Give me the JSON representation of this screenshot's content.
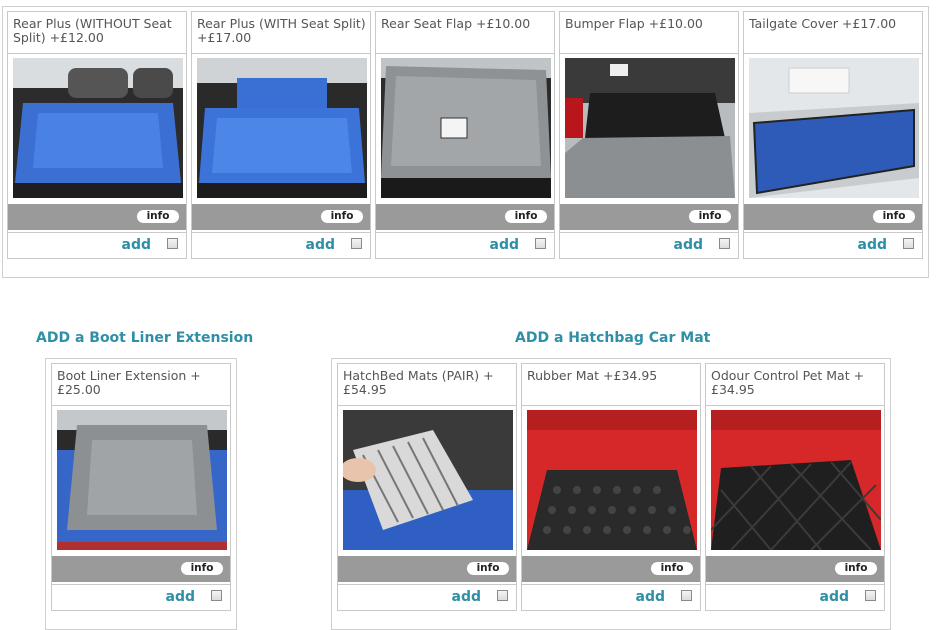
{
  "top_products": [
    {
      "title": "Rear Plus (WITHOUT Seat Split) +£12.00",
      "info_label": "info",
      "add_label": "add",
      "icon": "blue-boot-liner-image"
    },
    {
      "title": "Rear Plus (WITH Seat Split) +£17.00",
      "info_label": "info",
      "add_label": "add",
      "icon": "blue-split-liner-image"
    },
    {
      "title": "Rear Seat Flap +£10.00",
      "info_label": "info",
      "add_label": "add",
      "icon": "grey-seat-flap-image"
    },
    {
      "title": "Bumper Flap +£10.00",
      "info_label": "info",
      "add_label": "add",
      "icon": "bumper-flap-image"
    },
    {
      "title": "Tailgate Cover +£17.00",
      "info_label": "info",
      "add_label": "add",
      "icon": "tailgate-cover-image"
    }
  ],
  "extension_section": {
    "heading": "ADD a Boot Liner Extension",
    "products": [
      {
        "title": "Boot Liner Extension +£25.00",
        "info_label": "info",
        "add_label": "add",
        "icon": "extension-liner-image"
      }
    ]
  },
  "mat_section": {
    "heading": "ADD a Hatchbag Car Mat",
    "products": [
      {
        "title": "HatchBed Mats (PAIR) +£54.95",
        "info_label": "info",
        "add_label": "add",
        "icon": "hatchbed-mat-image"
      },
      {
        "title": "Rubber Mat +£34.95",
        "info_label": "info",
        "add_label": "add",
        "icon": "rubber-mat-image"
      },
      {
        "title": "Odour Control Pet  Mat  + £34.95",
        "info_label": "info",
        "add_label": "add",
        "icon": "pet-mat-image"
      }
    ]
  },
  "colors": {
    "accent": "#2e8fa6",
    "bar": "#9a9a9a",
    "border": "#c9c9c9"
  }
}
